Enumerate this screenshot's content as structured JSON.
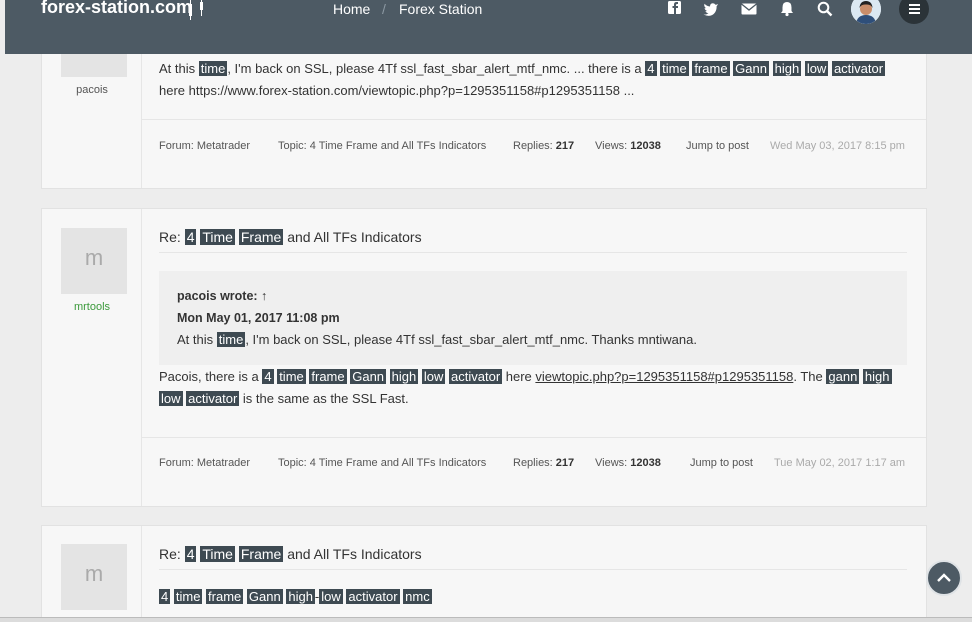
{
  "nav": {
    "brand": "forex-station.com",
    "home": "Home",
    "separator": "/",
    "forex_station": "Forex Station"
  },
  "colors": {
    "navbar": "#4d5a64",
    "highlight": "#3e4a52",
    "username_green": "#3b9a3b"
  },
  "post1": {
    "username": "pacois",
    "text": [
      {
        "t": "At this "
      },
      {
        "t": "time",
        "h": 1
      },
      {
        "t": ", I'm back on SSL, please 4Tf ssl_fast_sbar_alert_mtf_nmc. ... there is a "
      },
      {
        "t": "4",
        "h": 1
      },
      {
        "t": " "
      },
      {
        "t": "time",
        "h": 1
      },
      {
        "t": " "
      },
      {
        "t": "frame",
        "h": 1
      },
      {
        "t": " "
      },
      {
        "t": "Gann",
        "h": 1
      },
      {
        "t": " "
      },
      {
        "t": "high",
        "h": 1
      },
      {
        "t": " "
      },
      {
        "t": "low",
        "h": 1
      },
      {
        "t": " "
      },
      {
        "t": "activator",
        "h": 1
      },
      {
        "t": " here https://www.forex-station.com/viewtopic.php?p=1295351158#p1295351158 ..."
      }
    ],
    "footer": {
      "forum": "Forum: Metatrader",
      "topic": "Topic: 4 Time Frame and All TFs Indicators",
      "replies_label": "Replies: ",
      "replies": "217",
      "views_label": "Views: ",
      "views": "12038",
      "jump": "Jump to post",
      "date": "Wed May 03, 2017 8:15 pm"
    }
  },
  "post2": {
    "avatar_letter": "m",
    "username": "mrtools",
    "title": [
      {
        "t": "Re: "
      },
      {
        "t": "4",
        "h": 1
      },
      {
        "t": " "
      },
      {
        "t": "Time",
        "h": 1
      },
      {
        "t": " "
      },
      {
        "t": "Frame",
        "h": 1
      },
      {
        "t": " and All TFs Indicators"
      }
    ],
    "quote_author": "pacois wrote: ↑",
    "quote_date": "Mon May 01, 2017 11:08 pm",
    "quote_text": [
      {
        "t": "At this "
      },
      {
        "t": "time",
        "h": 1
      },
      {
        "t": ", I'm back on SSL, please 4Tf ssl_fast_sbar_alert_mtf_nmc. Thanks mntiwana."
      }
    ],
    "text": [
      {
        "t": "Pacois, there is a "
      },
      {
        "t": "4",
        "h": 1
      },
      {
        "t": " "
      },
      {
        "t": "time",
        "h": 1
      },
      {
        "t": " "
      },
      {
        "t": "frame",
        "h": 1
      },
      {
        "t": " "
      },
      {
        "t": "Gann",
        "h": 1
      },
      {
        "t": " "
      },
      {
        "t": "high",
        "h": 1
      },
      {
        "t": " "
      },
      {
        "t": "low",
        "h": 1
      },
      {
        "t": " "
      },
      {
        "t": "activator",
        "h": 1
      },
      {
        "t": " here "
      },
      {
        "t": "viewtopic.php?p=1295351158#p1295351158",
        "l": 1
      },
      {
        "t": ". The "
      },
      {
        "t": "gann",
        "h": 1
      },
      {
        "t": " "
      },
      {
        "t": "high",
        "h": 1
      },
      {
        "t": " "
      },
      {
        "t": "low",
        "h": 1
      },
      {
        "t": " "
      },
      {
        "t": "activator",
        "h": 1
      },
      {
        "t": " is the same as the SSL Fast."
      }
    ],
    "footer": {
      "forum": "Forum: Metatrader",
      "topic": "Topic: 4 Time Frame and All TFs Indicators",
      "replies_label": "Replies: ",
      "replies": "217",
      "views_label": "Views: ",
      "views": "12038",
      "jump": "Jump to post",
      "date": "Tue May 02, 2017 1:17 am"
    }
  },
  "post3": {
    "avatar_letter": "m",
    "title": [
      {
        "t": "Re: "
      },
      {
        "t": "4",
        "h": 1
      },
      {
        "t": " "
      },
      {
        "t": "Time",
        "h": 1
      },
      {
        "t": " "
      },
      {
        "t": "Frame",
        "h": 1
      },
      {
        "t": " and All TFs Indicators"
      }
    ],
    "text": [
      {
        "t": "4",
        "h": 1
      },
      {
        "t": " "
      },
      {
        "t": "time",
        "h": 1
      },
      {
        "t": " "
      },
      {
        "t": "frame",
        "h": 1
      },
      {
        "t": " "
      },
      {
        "t": "Gann",
        "h": 1
      },
      {
        "t": " "
      },
      {
        "t": "high",
        "h": 1
      },
      {
        "t": "-"
      },
      {
        "t": "low",
        "h": 1
      },
      {
        "t": " "
      },
      {
        "t": "activator",
        "h": 1
      },
      {
        "t": " "
      },
      {
        "t": "nmc",
        "h": 1
      }
    ]
  }
}
